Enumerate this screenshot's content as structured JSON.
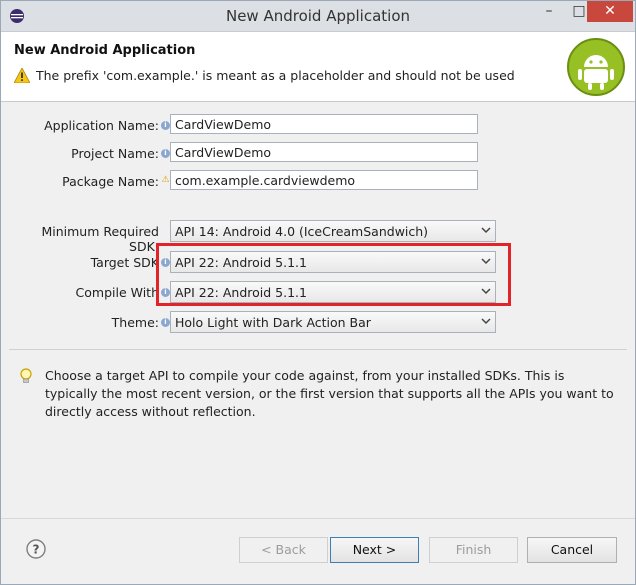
{
  "window": {
    "title": "New Android Application"
  },
  "header": {
    "title": "New Android Application",
    "message": "The prefix 'com.example.' is meant as a placeholder and should not be used"
  },
  "form": {
    "application_name": {
      "label": "Application Name:",
      "value": "CardViewDemo"
    },
    "project_name": {
      "label": "Project Name:",
      "value": "CardViewDemo"
    },
    "package_name": {
      "label": "Package Name:",
      "value": "com.example.cardviewdemo"
    },
    "min_sdk": {
      "label": "Minimum Required SDK:",
      "value": "API 14: Android 4.0 (IceCreamSandwich)"
    },
    "target_sdk": {
      "label": "Target SDK",
      "value": "API 22: Android 5.1.1"
    },
    "compile_with": {
      "label": "Compile With",
      "value": "API 22: Android 5.1.1"
    },
    "theme": {
      "label": "Theme:",
      "value": "Holo Light with Dark Action Bar"
    }
  },
  "hint": "Choose a target API to compile your code against, from your installed SDKs. This is typically the most recent version, or the first version that supports all the APIs you want to directly access without reflection.",
  "buttons": {
    "back": "< Back",
    "next": "Next >",
    "finish": "Finish",
    "cancel": "Cancel"
  },
  "colors": {
    "highlight": "#e0242a",
    "android_green": "#97c024",
    "close_button": "#c9483e"
  }
}
